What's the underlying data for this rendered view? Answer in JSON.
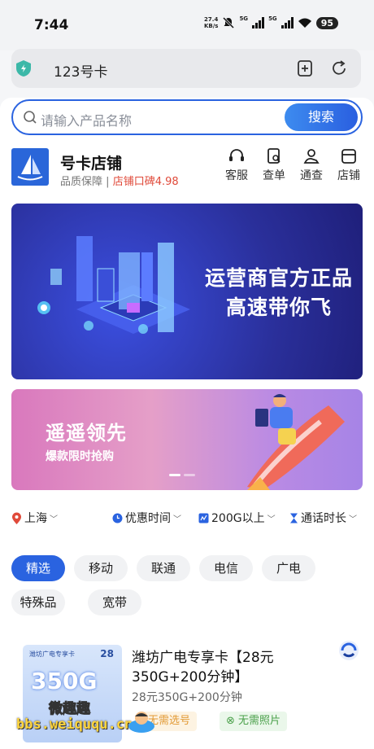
{
  "status": {
    "time": "7:44",
    "net_speed_value": "27.4",
    "net_speed_unit": "KB/s",
    "net1": "5G",
    "net2": "5G",
    "battery": "95"
  },
  "browser": {
    "url": "123号卡"
  },
  "search": {
    "placeholder": "请输入产品名称",
    "button": "搜索"
  },
  "shop": {
    "name": "号卡店铺",
    "guarantee": "品质保障",
    "separator": "|",
    "rating": "店铺口碑4.98",
    "actions": [
      {
        "label": "客服",
        "icon": "headset-icon"
      },
      {
        "label": "查单",
        "icon": "order-search-icon"
      },
      {
        "label": "通查",
        "icon": "person-hand-icon"
      },
      {
        "label": "店铺",
        "icon": "store-icon"
      }
    ]
  },
  "banner1": {
    "line1": "运营商官方正品",
    "line2": "高速带你飞"
  },
  "banner2": {
    "title": "遥遥领先",
    "subtitle": "爆款限时抢购"
  },
  "filters": [
    {
      "label": "上海",
      "icon": "location-pin-icon"
    },
    {
      "label": "优惠时间",
      "icon": "clock-icon"
    },
    {
      "label": "200G以上",
      "icon": "data-icon"
    },
    {
      "label": "通话时长",
      "icon": "hourglass-icon"
    }
  ],
  "categories": [
    "精选",
    "移动",
    "联通",
    "电信",
    "广电",
    "特殊品",
    "宽带"
  ],
  "selected_category": "精选",
  "product": {
    "title": "潍坊广电专享卡【28元350G+200分钟】",
    "description": "28元350G+200分钟",
    "tags": [
      "无需选号",
      "无需照片"
    ],
    "image_big_text": "350G",
    "image_price": "28",
    "image_header": "潍坊广电专享卡"
  },
  "watermark": {
    "top": "微趣趣",
    "bottom": "bbs.weiququ.cn"
  }
}
